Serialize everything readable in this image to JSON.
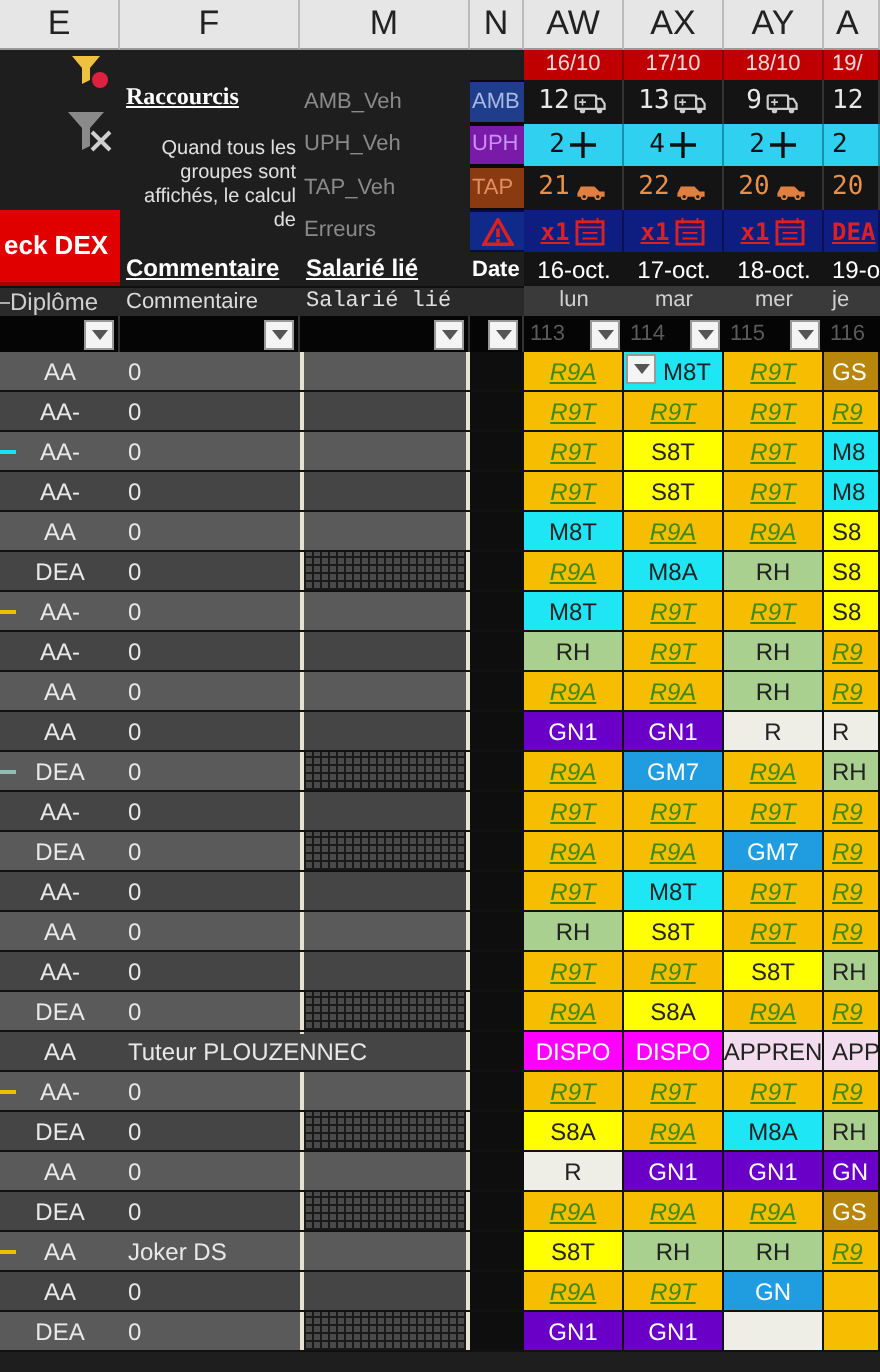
{
  "columns": [
    "E",
    "F",
    "M",
    "N",
    "AW",
    "AX",
    "AY",
    "A"
  ],
  "shortcuts": {
    "title": "Raccourcis",
    "note": "Quand tous les groupes sont affichés, le calcul de"
  },
  "check_button": "eck DEX",
  "side_rows": [
    {
      "kind": "amb",
      "label": "AMB_Veh",
      "badge": "AMB"
    },
    {
      "kind": "uph",
      "label": "UPH_Veh",
      "badge": "UPH"
    },
    {
      "kind": "tap",
      "label": "TAP_Veh",
      "badge": "TAP"
    },
    {
      "kind": "errors",
      "label": "Erreurs"
    }
  ],
  "headers": {
    "comment": "Commentaire",
    "employee": "Salarié lié",
    "date": "Date"
  },
  "subheaders": {
    "diploma": "Diplôme",
    "comment": "Commentaire",
    "employee": "Salarié lié"
  },
  "days": [
    {
      "date": "16/10",
      "amb": "12",
      "uph": "2",
      "tap": "21",
      "errors": "x1",
      "full_date": "16-oct.",
      "weekday": "lun",
      "filter": "113",
      "cut": false
    },
    {
      "date": "17/10",
      "amb": "13",
      "uph": "4",
      "tap": "22",
      "errors": "x1",
      "full_date": "17-oct.",
      "weekday": "mar",
      "filter": "114",
      "cut": false
    },
    {
      "date": "18/10",
      "amb": "9",
      "uph": "2",
      "tap": "20",
      "errors": "x1",
      "full_date": "18-oct.",
      "weekday": "mer",
      "filter": "115",
      "cut": false
    },
    {
      "date": "19/",
      "amb": "12",
      "uph": "2",
      "tap": "20",
      "errors": "DEA",
      "full_date": "19-o",
      "weekday": "je",
      "filter": "116",
      "cut": true
    }
  ],
  "rows": [
    {
      "diploma": "AA",
      "comment": "0",
      "hatched": false,
      "cells": [
        {
          "text": "R9A",
          "kind": "link",
          "color": "#f7bd00"
        },
        {
          "text": "M8T",
          "kind": "plain",
          "color": "#1ee6f5",
          "dropdown": true
        },
        {
          "text": "R9T",
          "kind": "link",
          "color": "#f7bd00"
        },
        {
          "text": "GS",
          "kind": "plain",
          "color": "#b8860b"
        }
      ]
    },
    {
      "diploma": "AA-",
      "comment": "0",
      "hatched": false,
      "cells": [
        {
          "text": "R9T",
          "kind": "link",
          "color": "#f7bd00"
        },
        {
          "text": "R9T",
          "kind": "link",
          "color": "#f7bd00"
        },
        {
          "text": "R9T",
          "kind": "link",
          "color": "#f7bd00"
        },
        {
          "text": "R9",
          "kind": "link",
          "color": "#f7bd00"
        }
      ]
    },
    {
      "diploma": "AA-",
      "comment": "0",
      "hatched": false,
      "color": "#19e0f0",
      "cells": [
        {
          "text": "R9T",
          "kind": "link",
          "color": "#f7bd00"
        },
        {
          "text": "S8T",
          "kind": "plain",
          "color": "#ffff00"
        },
        {
          "text": "R9T",
          "kind": "link",
          "color": "#f7bd00"
        },
        {
          "text": "M8",
          "kind": "plain",
          "color": "#1ee6f5"
        }
      ]
    },
    {
      "diploma": "AA-",
      "comment": "0",
      "hatched": false,
      "cells": [
        {
          "text": "R9T",
          "kind": "link",
          "color": "#f7bd00"
        },
        {
          "text": "S8T",
          "kind": "plain",
          "color": "#ffff00"
        },
        {
          "text": "R9T",
          "kind": "link",
          "color": "#f7bd00"
        },
        {
          "text": "M8",
          "kind": "plain",
          "color": "#1ee6f5"
        }
      ]
    },
    {
      "diploma": "AA",
      "comment": "0",
      "hatched": false,
      "cells": [
        {
          "text": "M8T",
          "kind": "plain",
          "color": "#1ee6f5"
        },
        {
          "text": "R9A",
          "kind": "link",
          "color": "#f7bd00"
        },
        {
          "text": "R9A",
          "kind": "link",
          "color": "#f7bd00"
        },
        {
          "text": "S8",
          "kind": "plain",
          "color": "#ffff00"
        }
      ]
    },
    {
      "diploma": "DEA",
      "comment": "0",
      "hatched": true,
      "cells": [
        {
          "text": "R9A",
          "kind": "link",
          "color": "#f7bd00"
        },
        {
          "text": "M8A",
          "kind": "plain",
          "color": "#1ee6f5"
        },
        {
          "text": "RH",
          "kind": "plain",
          "color": "#a9d08e"
        },
        {
          "text": "S8",
          "kind": "plain",
          "color": "#ffff00"
        }
      ]
    },
    {
      "diploma": "AA-",
      "comment": "0",
      "hatched": false,
      "color": "#f0c000",
      "cells": [
        {
          "text": "M8T",
          "kind": "plain",
          "color": "#1ee6f5"
        },
        {
          "text": "R9T",
          "kind": "link",
          "color": "#f7bd00"
        },
        {
          "text": "R9T",
          "kind": "link",
          "color": "#f7bd00"
        },
        {
          "text": "S8",
          "kind": "plain",
          "color": "#ffff00"
        }
      ]
    },
    {
      "diploma": "AA-",
      "comment": "0",
      "hatched": false,
      "cells": [
        {
          "text": "RH",
          "kind": "plain",
          "color": "#a9d08e"
        },
        {
          "text": "R9T",
          "kind": "link",
          "color": "#f7bd00"
        },
        {
          "text": "RH",
          "kind": "plain",
          "color": "#a9d08e"
        },
        {
          "text": "R9",
          "kind": "link",
          "color": "#f7bd00"
        }
      ]
    },
    {
      "diploma": "AA",
      "comment": "0",
      "hatched": false,
      "cells": [
        {
          "text": "R9A",
          "kind": "link",
          "color": "#f7bd00"
        },
        {
          "text": "R9A",
          "kind": "link",
          "color": "#f7bd00"
        },
        {
          "text": "RH",
          "kind": "plain",
          "color": "#a9d08e"
        },
        {
          "text": "R9",
          "kind": "link",
          "color": "#f7bd00"
        }
      ]
    },
    {
      "diploma": "AA",
      "comment": "0",
      "hatched": false,
      "cells": [
        {
          "text": "GN1",
          "kind": "plain",
          "color": "#6a00c8"
        },
        {
          "text": "GN1",
          "kind": "plain",
          "color": "#6a00c8"
        },
        {
          "text": "R",
          "kind": "plain",
          "color": "#eeeee6"
        },
        {
          "text": "R",
          "kind": "plain",
          "color": "#eeeee6"
        }
      ]
    },
    {
      "diploma": "DEA",
      "comment": "0",
      "hatched": true,
      "color": "#8fbfb0",
      "cells": [
        {
          "text": "R9A",
          "kind": "link",
          "color": "#f7bd00"
        },
        {
          "text": "GM7",
          "kind": "plain",
          "color": "#1f9de0"
        },
        {
          "text": "R9A",
          "kind": "link",
          "color": "#f7bd00"
        },
        {
          "text": "RH",
          "kind": "plain",
          "color": "#a9d08e"
        }
      ]
    },
    {
      "diploma": "AA-",
      "comment": "0",
      "hatched": false,
      "cells": [
        {
          "text": "R9T",
          "kind": "link",
          "color": "#f7bd00"
        },
        {
          "text": "R9T",
          "kind": "link",
          "color": "#f7bd00"
        },
        {
          "text": "R9T",
          "kind": "link",
          "color": "#f7bd00"
        },
        {
          "text": "R9",
          "kind": "link",
          "color": "#f7bd00"
        }
      ]
    },
    {
      "diploma": "DEA",
      "comment": "0",
      "hatched": true,
      "cells": [
        {
          "text": "R9A",
          "kind": "link",
          "color": "#f7bd00"
        },
        {
          "text": "R9A",
          "kind": "link",
          "color": "#f7bd00"
        },
        {
          "text": "GM7",
          "kind": "plain",
          "color": "#1f9de0"
        },
        {
          "text": "R9",
          "kind": "link",
          "color": "#f7bd00"
        }
      ]
    },
    {
      "diploma": "AA-",
      "comment": "0",
      "hatched": false,
      "cells": [
        {
          "text": "R9T",
          "kind": "link",
          "color": "#f7bd00"
        },
        {
          "text": "M8T",
          "kind": "plain",
          "color": "#1ee6f5"
        },
        {
          "text": "R9T",
          "kind": "link",
          "color": "#f7bd00"
        },
        {
          "text": "R9",
          "kind": "link",
          "color": "#f7bd00"
        }
      ]
    },
    {
      "diploma": "AA",
      "comment": "0",
      "hatched": false,
      "cells": [
        {
          "text": "RH",
          "kind": "plain",
          "color": "#a9d08e"
        },
        {
          "text": "S8T",
          "kind": "plain",
          "color": "#ffff00"
        },
        {
          "text": "R9T",
          "kind": "link",
          "color": "#f7bd00"
        },
        {
          "text": "R9",
          "kind": "link",
          "color": "#f7bd00"
        }
      ]
    },
    {
      "diploma": "AA-",
      "comment": "0",
      "hatched": false,
      "cells": [
        {
          "text": "R9T",
          "kind": "link",
          "color": "#f7bd00"
        },
        {
          "text": "R9T",
          "kind": "link",
          "color": "#f7bd00"
        },
        {
          "text": "S8T",
          "kind": "plain",
          "color": "#ffff00"
        },
        {
          "text": "RH",
          "kind": "plain",
          "color": "#a9d08e"
        }
      ]
    },
    {
      "diploma": "DEA",
      "comment": "0",
      "hatched": true,
      "cells": [
        {
          "text": "R9A",
          "kind": "link",
          "color": "#f7bd00"
        },
        {
          "text": "S8A",
          "kind": "plain",
          "color": "#ffff00"
        },
        {
          "text": "R9A",
          "kind": "link",
          "color": "#f7bd00"
        },
        {
          "text": "R9",
          "kind": "link",
          "color": "#f7bd00"
        }
      ]
    },
    {
      "diploma": "AA",
      "comment": "Tuteur PLOUZENNEC",
      "hatched": false,
      "cells": [
        {
          "text": "DISPO",
          "kind": "plain",
          "color": "#ff00ff"
        },
        {
          "text": "DISPO",
          "kind": "plain",
          "color": "#ff00ff"
        },
        {
          "text": "APPREN",
          "kind": "plain",
          "color": "#f2dcee"
        },
        {
          "text": "APP",
          "kind": "plain",
          "color": "#f2dcee"
        }
      ]
    },
    {
      "diploma": "AA-",
      "comment": "0",
      "hatched": false,
      "color": "#f0c000",
      "cells": [
        {
          "text": "R9T",
          "kind": "link",
          "color": "#f7bd00"
        },
        {
          "text": "R9T",
          "kind": "link",
          "color": "#f7bd00"
        },
        {
          "text": "R9T",
          "kind": "link",
          "color": "#f7bd00"
        },
        {
          "text": "R9",
          "kind": "link",
          "color": "#f7bd00"
        }
      ]
    },
    {
      "diploma": "DEA",
      "comment": "0",
      "hatched": true,
      "cells": [
        {
          "text": "S8A",
          "kind": "plain",
          "color": "#ffff00"
        },
        {
          "text": "R9A",
          "kind": "link",
          "color": "#f7bd00"
        },
        {
          "text": "M8A",
          "kind": "plain",
          "color": "#1ee6f5"
        },
        {
          "text": "RH",
          "kind": "plain",
          "color": "#a9d08e"
        }
      ]
    },
    {
      "diploma": "AA",
      "comment": "0",
      "hatched": false,
      "cells": [
        {
          "text": "R",
          "kind": "plain",
          "color": "#eeeee6"
        },
        {
          "text": "GN1",
          "kind": "plain",
          "color": "#6a00c8"
        },
        {
          "text": "GN1",
          "kind": "plain",
          "color": "#6a00c8"
        },
        {
          "text": "GN",
          "kind": "plain",
          "color": "#6a00c8"
        }
      ]
    },
    {
      "diploma": "DEA",
      "comment": "0",
      "hatched": true,
      "cells": [
        {
          "text": "R9A",
          "kind": "link",
          "color": "#f7bd00"
        },
        {
          "text": "R9A",
          "kind": "link",
          "color": "#f7bd00"
        },
        {
          "text": "R9A",
          "kind": "link",
          "color": "#f7bd00"
        },
        {
          "text": "GS",
          "kind": "plain",
          "color": "#b8860b"
        }
      ]
    },
    {
      "diploma": "AA",
      "comment": "Joker DS",
      "hatched": false,
      "color": "#f0c000",
      "cells": [
        {
          "text": "S8T",
          "kind": "plain",
          "color": "#ffff00"
        },
        {
          "text": "RH",
          "kind": "plain",
          "color": "#a9d08e"
        },
        {
          "text": "RH",
          "kind": "plain",
          "color": "#a9d08e"
        },
        {
          "text": "R9",
          "kind": "link",
          "color": "#f7bd00"
        }
      ]
    },
    {
      "diploma": "AA",
      "comment": "0",
      "hatched": false,
      "cells": [
        {
          "text": "R9A",
          "kind": "link",
          "color": "#f7bd00"
        },
        {
          "text": "R9T",
          "kind": "link",
          "color": "#f7bd00"
        },
        {
          "text": "GN",
          "kind": "plain",
          "color": "#1f9de0"
        },
        {
          "kind": "plain",
          "color": "#f7bd00"
        }
      ]
    },
    {
      "diploma": "DEA",
      "comment": "0",
      "hatched": true,
      "cells": [
        {
          "text": "GN1",
          "kind": "plain",
          "color": "#6a00c8"
        },
        {
          "text": "GN1",
          "kind": "plain",
          "color": "#6a00c8"
        },
        {
          "kind": "plain",
          "color": "#eeeee6"
        },
        {
          "kind": "plain",
          "color": "#f7bd00"
        }
      ]
    }
  ]
}
